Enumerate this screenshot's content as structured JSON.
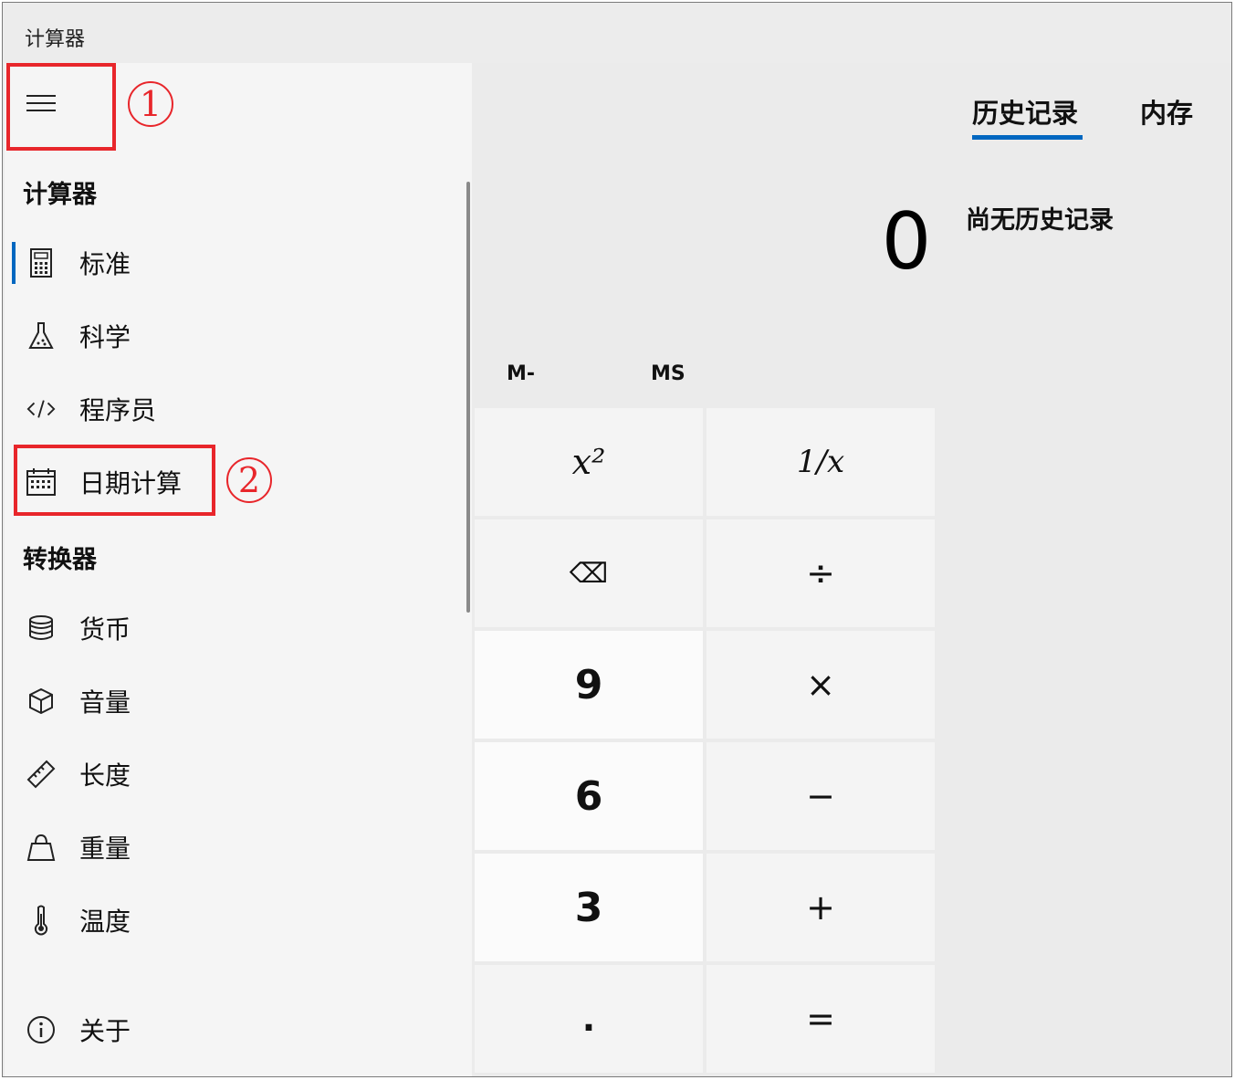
{
  "window": {
    "title": "计算器"
  },
  "sidebar": {
    "section_calculator": "计算器",
    "section_converter": "转换器",
    "calculator_items": [
      {
        "label": "标准",
        "icon": "calculator-icon",
        "active": true
      },
      {
        "label": "科学",
        "icon": "flask-icon"
      },
      {
        "label": "程序员",
        "icon": "code-icon"
      },
      {
        "label": "日期计算",
        "icon": "calendar-icon"
      }
    ],
    "converter_items": [
      {
        "label": "货币",
        "icon": "coins-icon"
      },
      {
        "label": "音量",
        "icon": "cube-icon"
      },
      {
        "label": "长度",
        "icon": "ruler-icon"
      },
      {
        "label": "重量",
        "icon": "weight-icon"
      },
      {
        "label": "温度",
        "icon": "thermometer-icon"
      }
    ],
    "about": {
      "label": "关于",
      "icon": "info-icon"
    }
  },
  "annotations": {
    "step1": "1",
    "step2": "2"
  },
  "tabs": {
    "history": "历史记录",
    "memory": "内存"
  },
  "history": {
    "empty_message": "尚无历史记录"
  },
  "display": {
    "value": "0"
  },
  "memory_buttons": {
    "m_minus": "M-",
    "ms": "MS"
  },
  "keypad": {
    "square": "x²",
    "reciprocal": "1/x",
    "backspace": "⌫",
    "divide": "÷",
    "nine": "9",
    "multiply": "×",
    "six": "6",
    "minus": "−",
    "three": "3",
    "plus": "+",
    "decimal": ".",
    "equals": "="
  },
  "colors": {
    "accent": "#0067c0",
    "annotation": "#e8262b"
  }
}
